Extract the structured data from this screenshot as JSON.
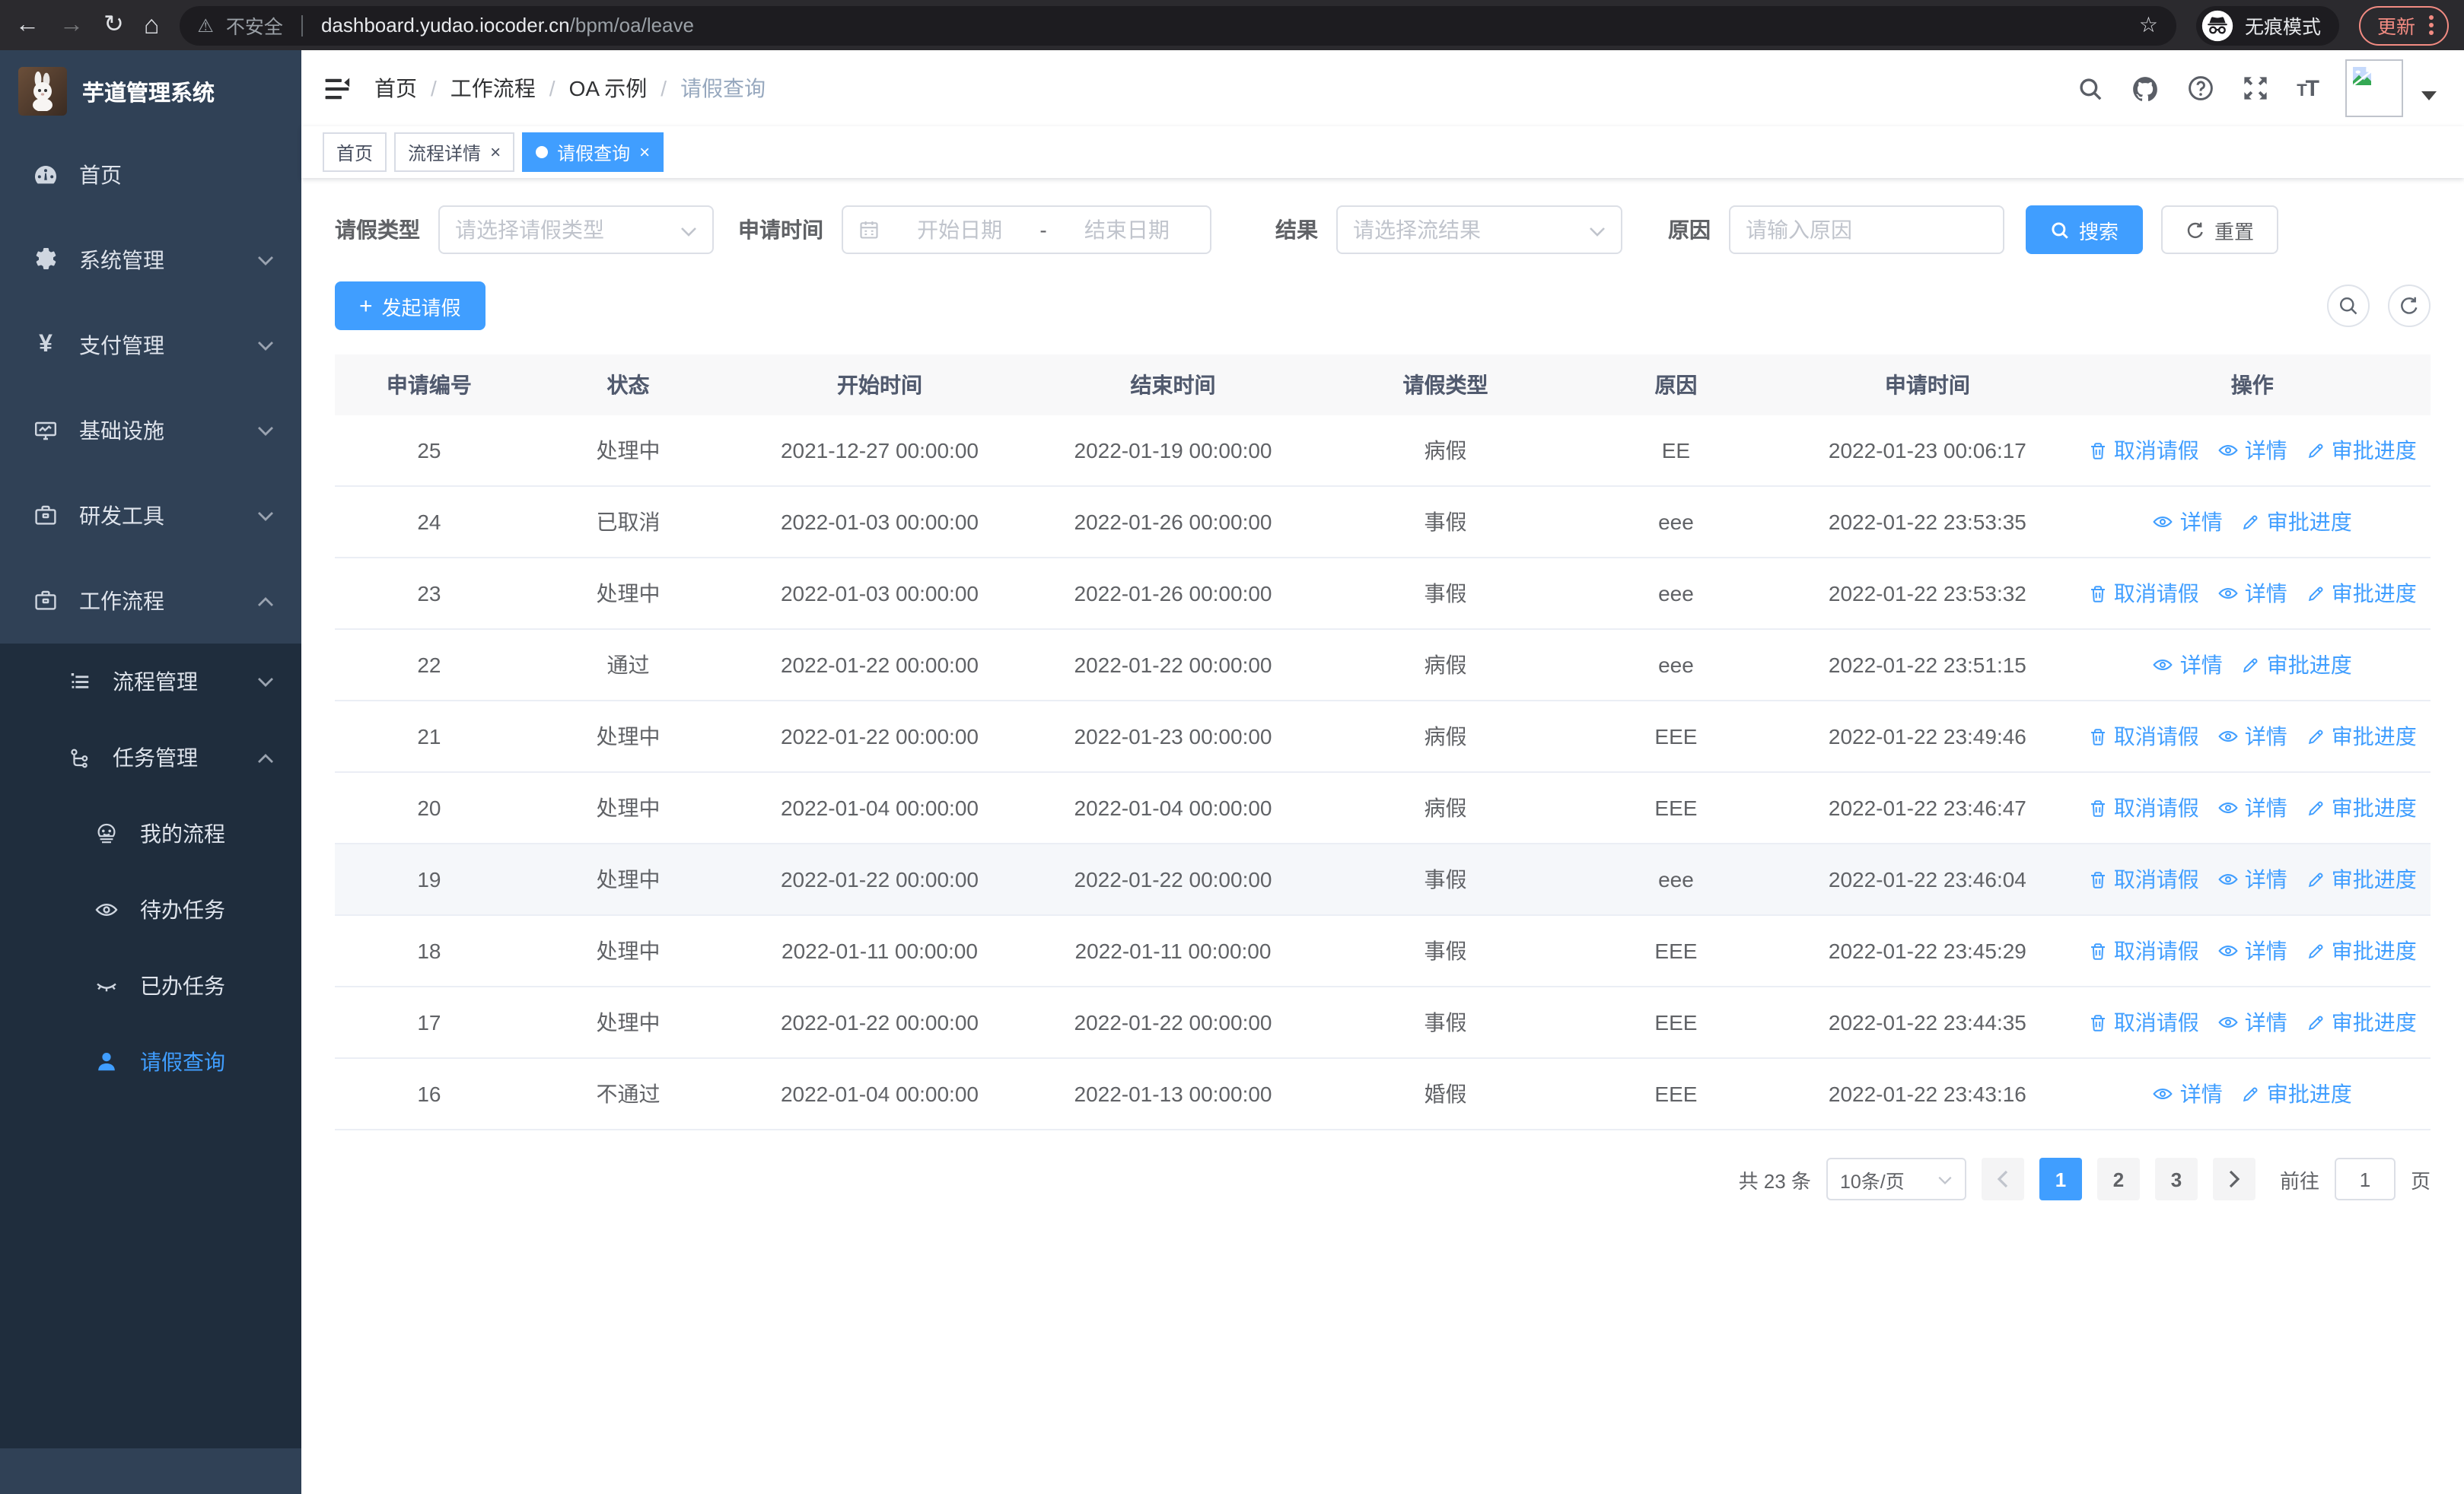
{
  "colors": {
    "accent": "#409eff",
    "sidebar_bg": "#304156",
    "submenu_bg": "#1f2d3d",
    "chrome_bg": "#2b2a2e",
    "update_badge": "#f28b82",
    "table_header_bg": "#f8f8f9",
    "row_hover_bg": "#f5f7fa"
  },
  "browser": {
    "security_label": "不安全",
    "url_host": "dashboard.yudao.iocoder.cn",
    "url_path": "/bpm/oa/leave",
    "incognito_label": "无痕模式",
    "update_label": "更新"
  },
  "sidebar": {
    "logo_title": "芋道管理系统",
    "items": [
      {
        "label": "首页"
      },
      {
        "label": "系统管理"
      },
      {
        "label": "支付管理"
      },
      {
        "label": "基础设施"
      },
      {
        "label": "研发工具"
      },
      {
        "label": "工作流程"
      },
      {
        "label": "流程管理"
      },
      {
        "label": "任务管理"
      },
      {
        "label": "我的流程"
      },
      {
        "label": "待办任务"
      },
      {
        "label": "已办任务"
      },
      {
        "label": "请假查询"
      }
    ]
  },
  "header": {
    "breadcrumbs": [
      "首页",
      "工作流程",
      "OA 示例",
      "请假查询"
    ]
  },
  "tags": [
    {
      "label": "首页"
    },
    {
      "label": "流程详情"
    },
    {
      "label": "请假查询"
    }
  ],
  "filters": {
    "leave_type_label": "请假类型",
    "leave_type_placeholder": "请选择请假类型",
    "apply_time_label": "申请时间",
    "start_date_placeholder": "开始日期",
    "range_separator": "-",
    "end_date_placeholder": "结束日期",
    "result_label": "结果",
    "result_placeholder": "请选择流结果",
    "reason_label": "原因",
    "reason_placeholder": "请输入原因",
    "search_label": "搜索",
    "reset_label": "重置"
  },
  "toolbar": {
    "create_label": "发起请假"
  },
  "table": {
    "columns": [
      "申请编号",
      "状态",
      "开始时间",
      "结束时间",
      "请假类型",
      "原因",
      "申请时间",
      "操作"
    ],
    "action_labels": {
      "cancel": "取消请假",
      "detail": "详情",
      "progress": "审批进度"
    },
    "rows": [
      {
        "id": "25",
        "status": "处理中",
        "start": "2021-12-27 00:00:00",
        "end": "2022-01-19 00:00:00",
        "type": "病假",
        "reason": "EE",
        "apply": "2022-01-23 00:06:17",
        "actions": [
          "cancel",
          "detail",
          "progress"
        ]
      },
      {
        "id": "24",
        "status": "已取消",
        "start": "2022-01-03 00:00:00",
        "end": "2022-01-26 00:00:00",
        "type": "事假",
        "reason": "eee",
        "apply": "2022-01-22 23:53:35",
        "actions": [
          "detail",
          "progress"
        ]
      },
      {
        "id": "23",
        "status": "处理中",
        "start": "2022-01-03 00:00:00",
        "end": "2022-01-26 00:00:00",
        "type": "事假",
        "reason": "eee",
        "apply": "2022-01-22 23:53:32",
        "actions": [
          "cancel",
          "detail",
          "progress"
        ]
      },
      {
        "id": "22",
        "status": "通过",
        "start": "2022-01-22 00:00:00",
        "end": "2022-01-22 00:00:00",
        "type": "病假",
        "reason": "eee",
        "apply": "2022-01-22 23:51:15",
        "actions": [
          "detail",
          "progress"
        ]
      },
      {
        "id": "21",
        "status": "处理中",
        "start": "2022-01-22 00:00:00",
        "end": "2022-01-23 00:00:00",
        "type": "病假",
        "reason": "EEE",
        "apply": "2022-01-22 23:49:46",
        "actions": [
          "cancel",
          "detail",
          "progress"
        ]
      },
      {
        "id": "20",
        "status": "处理中",
        "start": "2022-01-04 00:00:00",
        "end": "2022-01-04 00:00:00",
        "type": "病假",
        "reason": "EEE",
        "apply": "2022-01-22 23:46:47",
        "actions": [
          "cancel",
          "detail",
          "progress"
        ]
      },
      {
        "id": "19",
        "status": "处理中",
        "start": "2022-01-22 00:00:00",
        "end": "2022-01-22 00:00:00",
        "type": "事假",
        "reason": "eee",
        "apply": "2022-01-22 23:46:04",
        "actions": [
          "cancel",
          "detail",
          "progress"
        ],
        "hover": true
      },
      {
        "id": "18",
        "status": "处理中",
        "start": "2022-01-11 00:00:00",
        "end": "2022-01-11 00:00:00",
        "type": "事假",
        "reason": "EEE",
        "apply": "2022-01-22 23:45:29",
        "actions": [
          "cancel",
          "detail",
          "progress"
        ]
      },
      {
        "id": "17",
        "status": "处理中",
        "start": "2022-01-22 00:00:00",
        "end": "2022-01-22 00:00:00",
        "type": "事假",
        "reason": "EEE",
        "apply": "2022-01-22 23:44:35",
        "actions": [
          "cancel",
          "detail",
          "progress"
        ]
      },
      {
        "id": "16",
        "status": "不通过",
        "start": "2022-01-04 00:00:00",
        "end": "2022-01-13 00:00:00",
        "type": "婚假",
        "reason": "EEE",
        "apply": "2022-01-22 23:43:16",
        "actions": [
          "detail",
          "progress"
        ]
      }
    ]
  },
  "pagination": {
    "total_label": "共 23 条",
    "page_size": "10条/页",
    "pages": [
      "1",
      "2",
      "3"
    ],
    "active_page": "1",
    "goto_label": "前往",
    "goto_value": "1",
    "page_unit_label": "页"
  }
}
